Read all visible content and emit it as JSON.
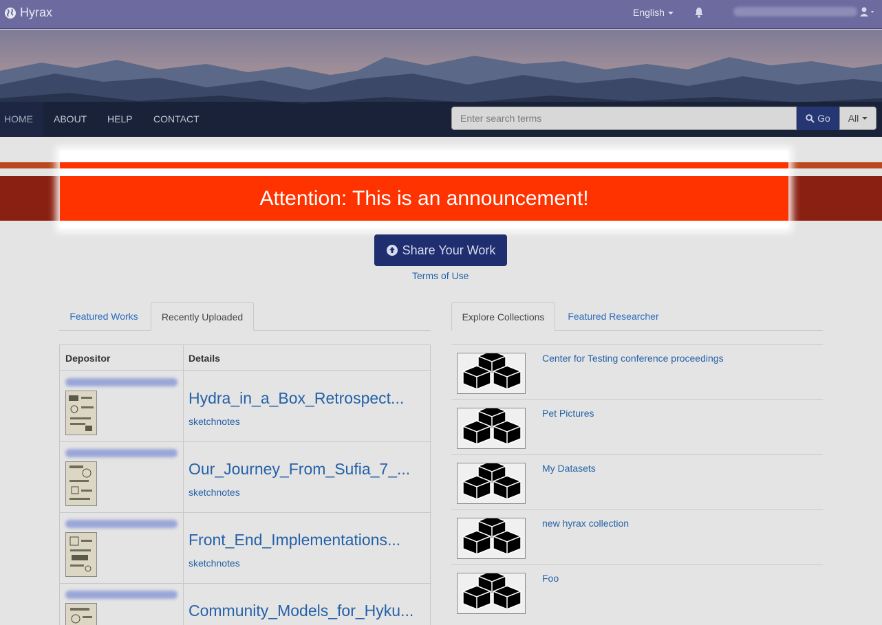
{
  "brand": {
    "name": "Hyrax"
  },
  "topnav": {
    "language": "English"
  },
  "mainnav": {
    "items": [
      {
        "label": "HOME"
      },
      {
        "label": "ABOUT"
      },
      {
        "label": "HELP"
      },
      {
        "label": "CONTACT"
      }
    ]
  },
  "search": {
    "placeholder": "Enter search terms",
    "go_label": "Go",
    "scope_label": "All"
  },
  "announcement": {
    "text": "Attention: This is an announcement!"
  },
  "share": {
    "label": "Share Your Work",
    "terms_label": "Terms of Use"
  },
  "left_tabs": [
    {
      "label": "Featured Works"
    },
    {
      "label": "Recently Uploaded"
    }
  ],
  "right_tabs": [
    {
      "label": "Explore Collections"
    },
    {
      "label": "Featured Researcher"
    }
  ],
  "recent": {
    "headers": {
      "depositor": "Depositor",
      "details": "Details"
    },
    "rows": [
      {
        "title": "Hydra_in_a_Box_Retrospect...",
        "tag": "sketchnotes"
      },
      {
        "title": "Our_Journey_From_Sufia_7_...",
        "tag": "sketchnotes"
      },
      {
        "title": "Front_End_Implementations...",
        "tag": "sketchnotes"
      },
      {
        "title": "Community_Models_for_Hyku...",
        "tag": ""
      }
    ]
  },
  "collections": [
    {
      "name": "Center for Testing conference proceedings"
    },
    {
      "name": "Pet Pictures"
    },
    {
      "name": "My Datasets"
    },
    {
      "name": "new hyrax collection"
    },
    {
      "name": "Foo"
    }
  ],
  "colors": {
    "navbar": "#6c6a9e",
    "announcement": "#ff3300",
    "primary_button": "#1f2e6e",
    "link": "#2461a8"
  },
  "icons": {
    "brand": "globe-icon",
    "notifications": "bell-icon",
    "user": "user-icon",
    "search": "search-icon",
    "upload": "upload-icon",
    "collection": "cubes-icon"
  }
}
